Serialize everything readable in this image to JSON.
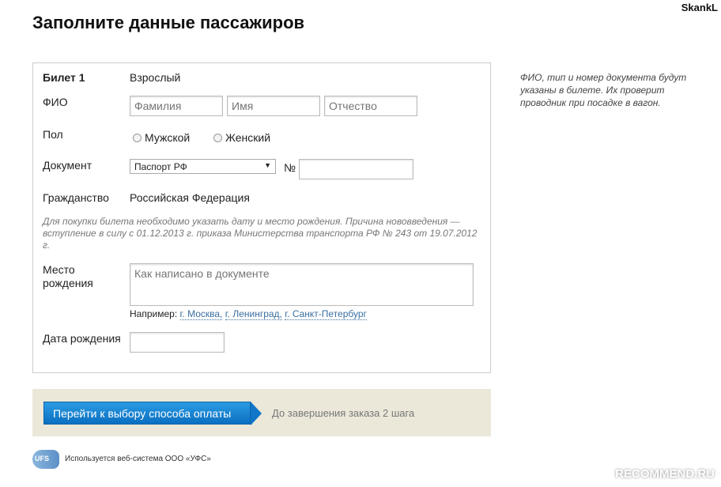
{
  "user": "SkankL",
  "title": "Заполните данные пассажиров",
  "ticket": {
    "label": "Билет 1",
    "type": "Взрослый"
  },
  "fio": {
    "label": "ФИО",
    "surname_placeholder": "Фамилия",
    "name_placeholder": "Имя",
    "patronymic_placeholder": "Отчество"
  },
  "gender": {
    "label": "Пол",
    "male": "Мужской",
    "female": "Женский"
  },
  "document": {
    "label": "Документ",
    "selected": "Паспорт РФ",
    "number_label": "№",
    "number_value": ""
  },
  "citizenship": {
    "label": "Гражданство",
    "value": "Российская Федерация"
  },
  "birth_notice": "Для покупки билета необходимо указать дату и место рождения. Причина нововведения — вступление в силу с 01.12.2013 г. приказа Министерства транспорта РФ № 243 от 19.07.2012 г.",
  "birthplace": {
    "label": "Место рождения",
    "placeholder": "Как написано в документе",
    "example_label": "Например:",
    "examples": [
      "г. Москва,",
      "г. Ленинград,",
      "г. Санкт-Петербург"
    ]
  },
  "birthdate": {
    "label": "Дата рождения",
    "value": ""
  },
  "side_note": "ФИО, тип и номер документа будут указаны в билете. Их проверит проводник при посадке в вагон.",
  "next_button": "Перейти к выбору способа оплаты",
  "steps_left": "До завершения заказа 2 шага",
  "footer": {
    "logo": "UFS",
    "text": "Используется веб-система ООО «УФС»"
  },
  "watermark": "RECOMMEND.RU"
}
